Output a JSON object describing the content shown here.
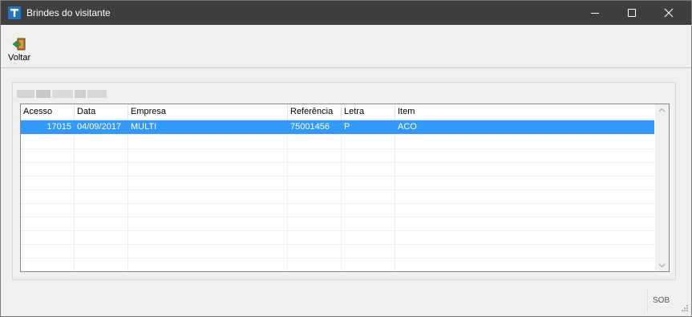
{
  "window": {
    "title": "Brindes do visitante"
  },
  "toolbar": {
    "back_label": "Voltar"
  },
  "table": {
    "columns": [
      "Acesso",
      "Data",
      "Empresa",
      "Referência",
      "Letra",
      "Item"
    ],
    "rows": [
      [
        "17015",
        "04/09/2017",
        "MULTI",
        "75001456",
        "P",
        "ACO"
      ]
    ]
  },
  "status": {
    "code": "SOB"
  },
  "icons": {
    "app": "app-logo-icon",
    "back": "exit-door-icon",
    "minimize": "minimize-icon",
    "maximize": "maximize-icon",
    "close": "close-icon"
  },
  "colors": {
    "titlebar": "#3f3f3f",
    "selection": "#3399ff",
    "app_icon": "#1f74c8"
  }
}
